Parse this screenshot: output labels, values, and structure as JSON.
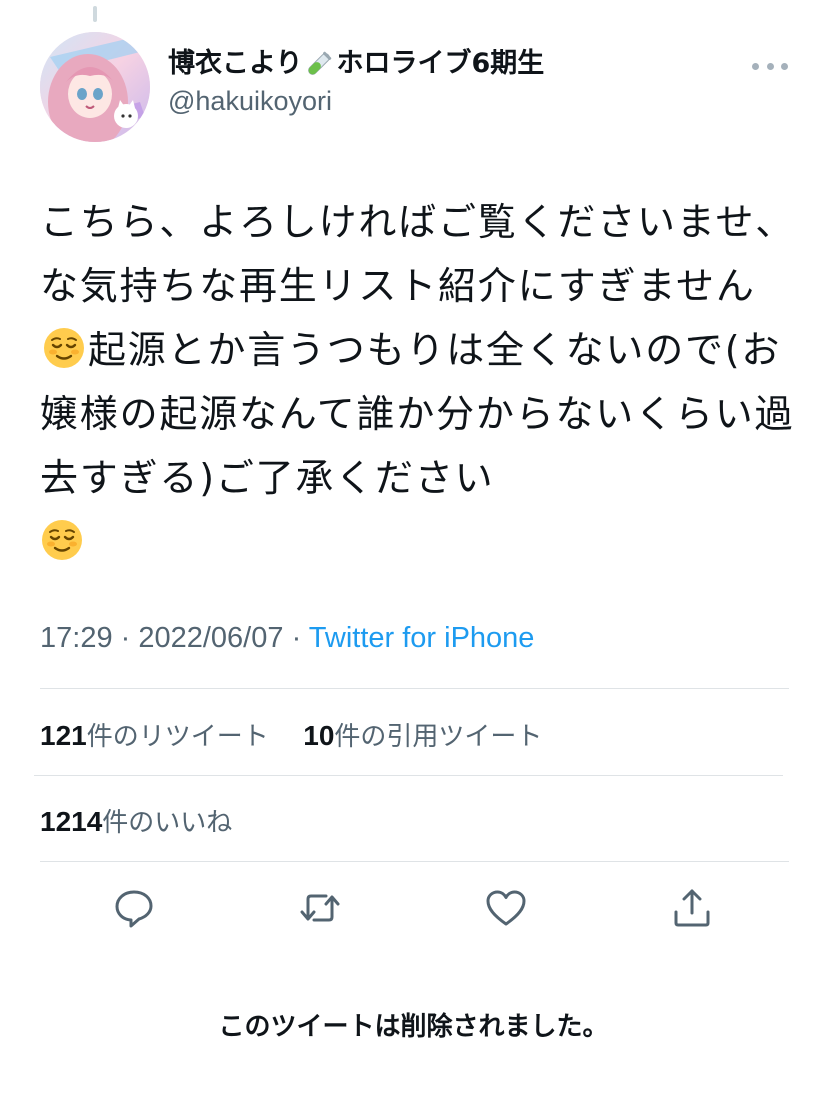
{
  "tweet": {
    "author": {
      "display_name": "博衣こより",
      "name_suffix": "ホロライブ6期生",
      "name_emoji": "test-tube-icon",
      "handle": "@hakuikoyori"
    },
    "text": {
      "part1": "こちら、よろしければご覧くださいませ、な気持ちな再生リスト紹介にすぎません",
      "emoji1": "relieved-face-icon",
      "part2": "起源とか言うつもりは全くないので(お嬢様の起源なんて誰か分からないくらい過去すぎる)ご了承ください",
      "emoji2": "relieved-face-icon"
    },
    "meta": {
      "time": "17:29",
      "separator": " · ",
      "date": "2022/06/07",
      "source": "Twitter for iPhone"
    },
    "stats": {
      "retweets_count": "121",
      "retweets_label": "件のリツイート",
      "quotes_count": "10",
      "quotes_label": "件の引用ツイート",
      "likes_count": "1214",
      "likes_label": "件のいいね"
    },
    "actions": [
      "reply-icon",
      "retweet-icon",
      "like-icon",
      "share-icon"
    ],
    "deleted_notice": "このツイートは削除されました。"
  },
  "colors": {
    "text": "#0f1419",
    "secondary": "#536471",
    "link": "#1d9bf0",
    "divider": "#dfe3e6"
  }
}
